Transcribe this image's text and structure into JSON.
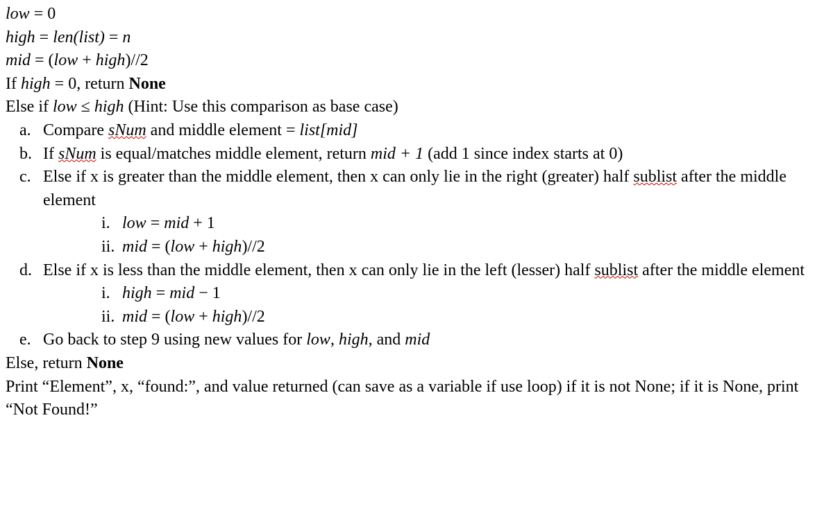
{
  "lines": {
    "l1_low": "low",
    "l1_eq": " = 0",
    "l2_high": "high",
    "l2_eq": " = ",
    "l2_len": "len(list)",
    "l2_eq_n": " = ",
    "l2_n": "n",
    "l3_mid": "mid",
    "l3_eq": " = (",
    "l3_low": "low",
    "l3_plus": " + ",
    "l3_high": "high",
    "l3_close": ")//2",
    "l4_if": "If ",
    "l4_high": "high",
    "l4_eq": " = 0, return ",
    "l4_none": "None",
    "l5_else": "Else if ",
    "l5_low": "low",
    "l5_le": " ≤ ",
    "l5_high": "high",
    "l5_hint": " (Hint: Use this comparison as base case)",
    "a_marker": "a.",
    "a_compare": "Compare ",
    "a_snum": "sNum",
    "a_and": " and middle element = ",
    "a_list": "list[mid]",
    "b_marker": "b.",
    "b_if": "If ",
    "b_snum": "sNum",
    "b_text": " is equal/matches middle element, return ",
    "b_mid1": "mid + 1",
    "b_add": " (add 1 since index starts at 0)",
    "c_marker": "c.",
    "c_text1": "Else if x is greater than the middle element, then x can only lie in the right (greater) half ",
    "c_sublist": "sublist",
    "c_text2": " after the middle element",
    "ci_marker": "i.",
    "ci_low": "low",
    "ci_eq": " = ",
    "ci_mid": "mid",
    "ci_plus1": " + 1",
    "cii_marker": "ii.",
    "cii_mid": "mid",
    "cii_eq": " = (",
    "cii_low": "low",
    "cii_plus": " + ",
    "cii_high": "high",
    "cii_close": ")//2",
    "d_marker": "d.",
    "d_text1": "Else if x is less than the middle element, then x can only lie in the left (lesser) half ",
    "d_sublist": "sublist",
    "d_text2": " after the middle element",
    "di_marker": "i.",
    "di_high": "high",
    "di_eq": " = ",
    "di_mid": "mid",
    "di_minus1": " − 1",
    "dii_marker": "ii.",
    "dii_mid": "mid",
    "dii_eq": " = (",
    "dii_low": "low",
    "dii_plus": " + ",
    "dii_high": "high",
    "dii_close": ")//2",
    "e_marker": "e.",
    "e_text1": "Go back to step 9 using new values for ",
    "e_low": "low",
    "e_comma1": ", ",
    "e_high": "high",
    "e_comma2": ", and ",
    "e_mid": "mid",
    "else_text": "Else, return ",
    "else_none": "None",
    "print1": "Print “Element”, x, “found:”, and value returned (can save as a variable if use loop) if it is not None; if it is None, print “Not Found!”"
  }
}
